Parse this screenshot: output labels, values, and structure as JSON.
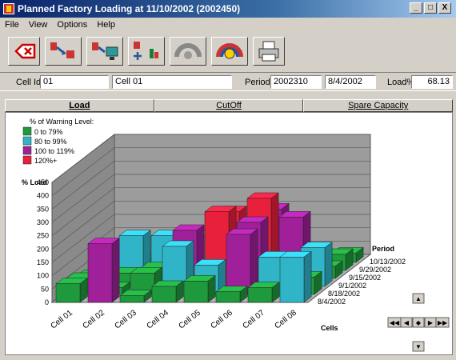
{
  "window": {
    "title": "Planned Factory Loading at 11/10/2002 (2002450)"
  },
  "window_controls": {
    "minimize": "_",
    "maximize": "□",
    "close": "X"
  },
  "menu": [
    "File",
    "View",
    "Options",
    "Help"
  ],
  "toolbar": {
    "buttons": [
      {
        "icon": "delete-icon"
      },
      {
        "icon": "transfer-red-icon"
      },
      {
        "icon": "transfer-screen-icon"
      },
      {
        "icon": "add-load-icon"
      },
      {
        "icon": "fan-chart-disabled-icon"
      },
      {
        "icon": "fan-chart-icon"
      },
      {
        "icon": "printer-icon"
      }
    ]
  },
  "fields": {
    "cell_id_label": "Cell Id",
    "cell_id_value": "01",
    "cell_name_value": "Cell 01",
    "period_label": "Period",
    "period_value": "2002310",
    "period_date": "8/4/2002",
    "load_pct_label": "Load%",
    "load_pct_value": "68.13"
  },
  "tabs": [
    {
      "label": "Load",
      "active": true
    },
    {
      "label": "CutOff",
      "active": false
    },
    {
      "label": "Spare Capacity",
      "active": false
    }
  ],
  "legend": {
    "title": "% of Warning Level:",
    "items": [
      {
        "label": "0 to 79%",
        "color": "#1e9a3c"
      },
      {
        "label": "80 to 99%",
        "color": "#2fb4c8"
      },
      {
        "label": "100 to 119%",
        "color": "#a0209a"
      },
      {
        "label": "120%+",
        "color": "#e8203c"
      }
    ]
  },
  "chart_data": {
    "type": "bar",
    "ylabel": "% Load",
    "ylim": [
      0,
      450
    ],
    "yticks": [
      0,
      50,
      100,
      150,
      200,
      250,
      300,
      350,
      400,
      450
    ],
    "xlabel": "Cells",
    "zlabel": "Period",
    "categories": [
      "Cell 01",
      "Cell 02",
      "Cell 03",
      "Cell 04",
      "Cell 05",
      "Cell 06",
      "Cell 07",
      "Cell 08"
    ],
    "periods": [
      "8/4/2002",
      "8/18/2002",
      "9/1/2002",
      "9/15/2002",
      "9/29/2002",
      "10/13/2002"
    ],
    "values": [
      [
        70,
        220,
        25,
        60,
        80,
        40,
        55,
        170
      ],
      [
        60,
        25,
        80,
        180,
        110,
        225,
        140,
        65
      ],
      [
        40,
        50,
        70,
        210,
        280,
        240,
        95,
        145
      ],
      [
        30,
        160,
        160,
        160,
        250,
        300,
        230,
        45
      ],
      [
        20,
        20,
        35,
        35,
        70,
        230,
        40,
        60
      ],
      [
        15,
        15,
        10,
        10,
        10,
        15,
        20,
        35
      ]
    ]
  },
  "nav": {
    "up_label": "▲",
    "down_label": "▼",
    "left_label": "◀",
    "right_label": "▶",
    "first_label": "◀◀",
    "last_label": "▶▶",
    "center_label": "◆"
  }
}
